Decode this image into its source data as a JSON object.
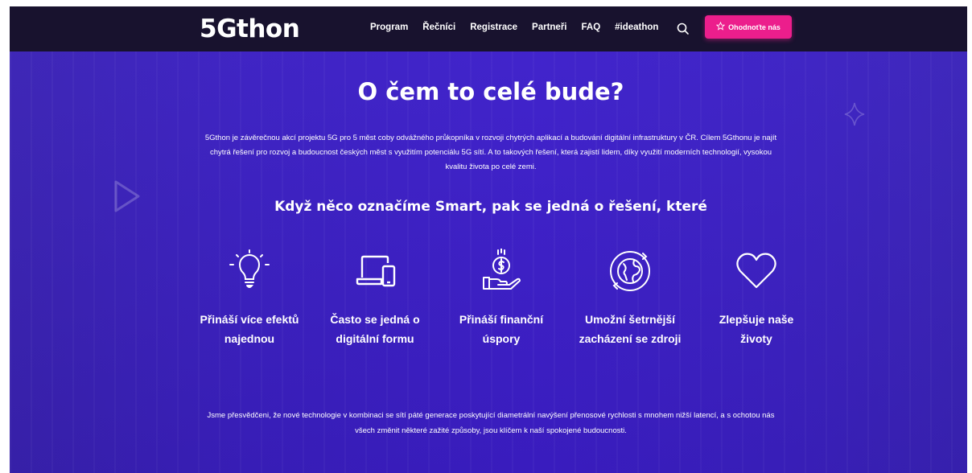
{
  "header": {
    "logo": "5Gthon",
    "menu": [
      "Program",
      "Řečníci",
      "Registrace",
      "Partneři",
      "FAQ",
      "#ideathon"
    ],
    "search_icon": "search-icon",
    "rate_button": {
      "label": "Ohodnoťte nás",
      "icon": "star-icon",
      "color": "#ec1e8c"
    },
    "background": "#18122e"
  },
  "hero": {
    "background": "#3c1fc4",
    "title": "O čem to celé bude?",
    "intro": "5Gthon je závěrečnou akcí projektu 5G pro 5 měst coby odvážného průkopníka v rozvoji chytrých aplikací a budování digitální infrastruktury v ČR. Cílem 5Gthonu je najít chytrá řešení pro rozvoj a budoucnost českých měst s využitím potenciálu 5G sítí. A to takových řešení, která zajistí lidem, díky využití moderních technologií, vysokou kvalitu života po celé zemi.",
    "subtitle": "Když něco označíme Smart, pak se jedná o řešení, které",
    "features": [
      {
        "icon": "lightbulb-icon",
        "label": "Přináší více efektů najednou"
      },
      {
        "icon": "devices-icon",
        "label": "Často se jedná o digitální formu"
      },
      {
        "icon": "money-hand-icon",
        "label": "Přináší finanční úspory"
      },
      {
        "icon": "globe-recycle-icon",
        "label": "Umožní šetrnější zacházení se zdroji"
      },
      {
        "icon": "heart-icon",
        "label": "Zlepšuje naše životy"
      }
    ],
    "outro": "Jsme přesvědčeni, že nové technologie v kombinaci se sítí páté generace poskytující diametrální navýšení přenosové rychlosti s mnohem nižší latencí, a s ochotou nás všech změnit některé zažité způsoby, jsou klíčem k naší spokojené budoucnosti."
  }
}
